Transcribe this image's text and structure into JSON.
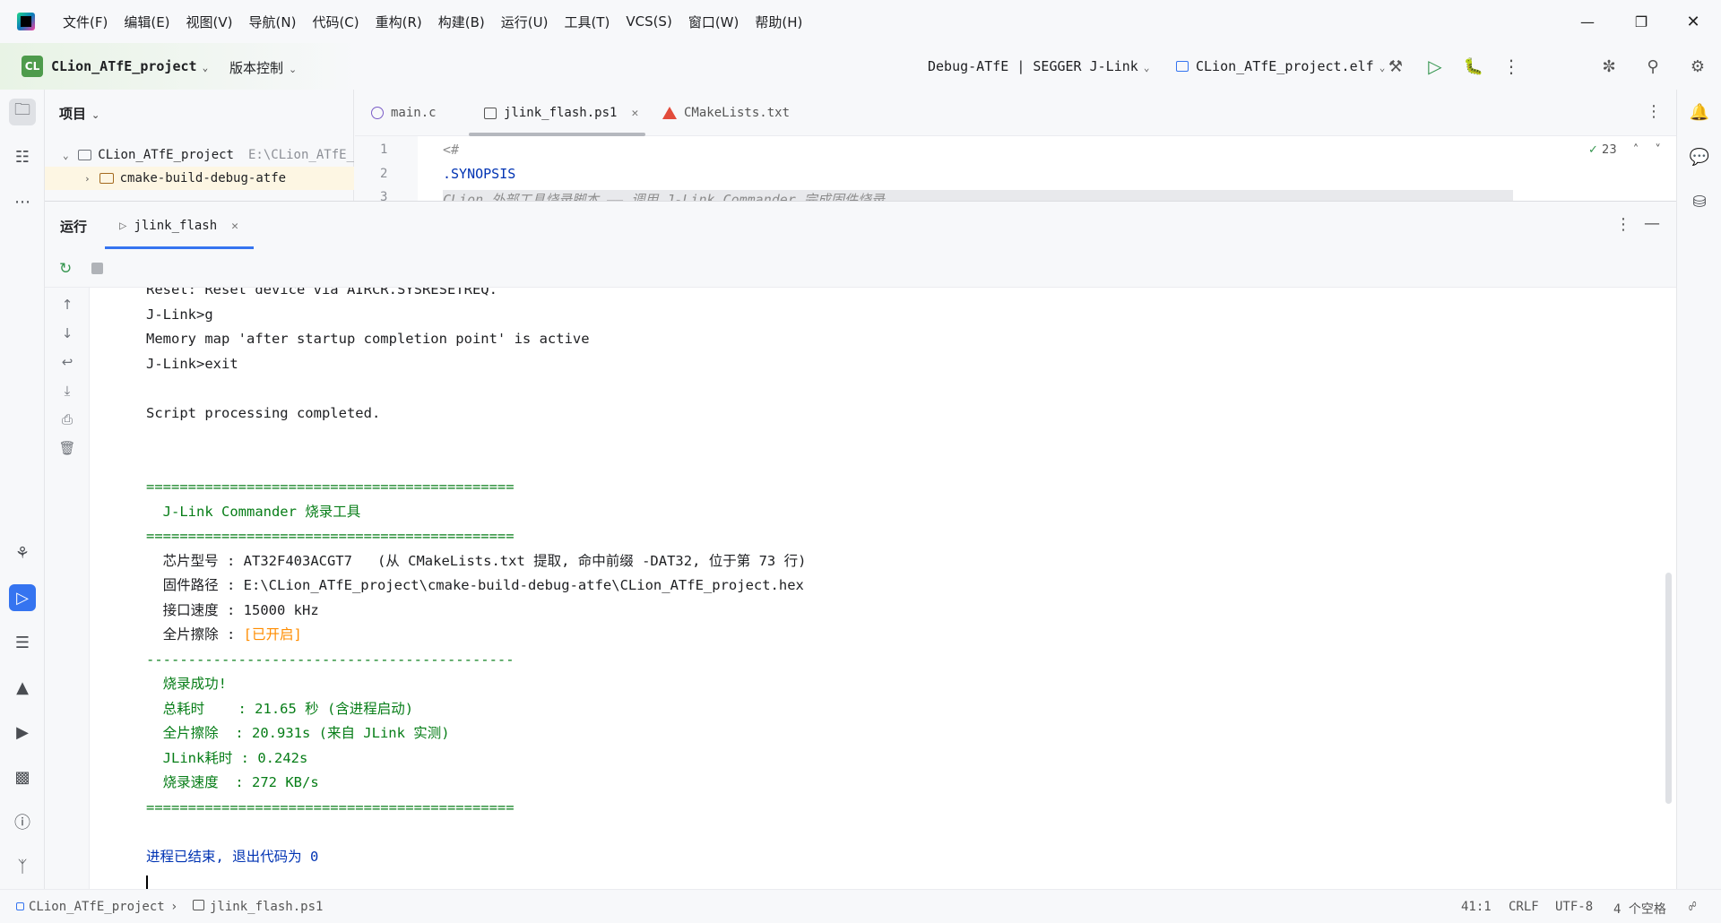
{
  "menubar": {
    "items": [
      "文件(F)",
      "编辑(E)",
      "视图(V)",
      "导航(N)",
      "代码(C)",
      "重构(R)",
      "构建(B)",
      "运行(U)",
      "工具(T)",
      "VCS(S)",
      "窗口(W)",
      "帮助(H)"
    ]
  },
  "toolbar": {
    "project_badge": "CL",
    "project_name": "CLion_ATfE_project",
    "vcs_label": "版本控制",
    "run_config": "Debug-ATfE | SEGGER J-Link",
    "target": "CLion_ATfE_project.elf"
  },
  "project_panel": {
    "title": "项目",
    "root_name": "CLion_ATfE_project",
    "root_path": "E:\\CLion_ATfE_",
    "child": "cmake-build-debug-atfe"
  },
  "editor": {
    "tabs": [
      {
        "label": "main.c"
      },
      {
        "label": "jlink_flash.ps1"
      },
      {
        "label": "CMakeLists.txt"
      }
    ],
    "inspection_count": "23",
    "lines": [
      {
        "no": "1",
        "text": "<#"
      },
      {
        "no": "2",
        "text": ".SYNOPSIS"
      },
      {
        "no": "3",
        "text": "    CLion 外部工具烧录脚本 —— 调用 J-Link Commander 完成固件烧录"
      }
    ]
  },
  "run_window": {
    "title": "运行",
    "tab_label": "jlink_flash",
    "console": [
      {
        "text": "Reset: Reset device via AIRCR.SYSRESETREQ.",
        "style": "clip"
      },
      {
        "text": "J-Link>g",
        "style": "black"
      },
      {
        "text": "Memory map 'after startup completion point' is active",
        "style": "black"
      },
      {
        "text": "J-Link>exit",
        "style": "black"
      },
      {
        "text": "",
        "style": "black"
      },
      {
        "text": "Script processing completed.",
        "style": "black"
      },
      {
        "text": "",
        "style": "black"
      },
      {
        "text": "",
        "style": "black"
      },
      {
        "text": "============================================",
        "style": "green"
      },
      {
        "text": "  J-Link Commander 烧录工具",
        "style": "green"
      },
      {
        "text": "============================================",
        "style": "green"
      },
      {
        "text": "  芯片型号 : AT32F403ACGT7   (从 CMakeLists.txt 提取, 命中前缀 -DAT32, 位于第 73 行)",
        "style": "black"
      },
      {
        "text": "  固件路径 : E:\\CLion_ATfE_project\\cmake-build-debug-atfe\\CLion_ATfE_project.hex",
        "style": "black"
      },
      {
        "text": "  接口速度 : 15000 kHz",
        "style": "black"
      },
      {
        "text": "  全片擦除 : ",
        "style": "black",
        "suffix": "[已开启]"
      },
      {
        "text": "--------------------------------------------",
        "style": "green"
      },
      {
        "text": "  烧录成功!",
        "style": "green"
      },
      {
        "text": "  总耗时    : 21.65 秒 (含进程启动)",
        "style": "green"
      },
      {
        "text": "  全片擦除  : 20.931s (来自 JLink 实测)",
        "style": "green"
      },
      {
        "text": "  JLink耗时 : 0.242s",
        "style": "green"
      },
      {
        "text": "  烧录速度  : 272 KB/s",
        "style": "green"
      },
      {
        "text": "============================================",
        "style": "green"
      },
      {
        "text": "",
        "style": "black"
      },
      {
        "text": "进程已结束, 退出代码为 0",
        "style": "blue"
      }
    ]
  },
  "statusbar": {
    "project": "CLion_ATfE_project",
    "file": "jlink_flash.ps1",
    "position": "41:1",
    "line_sep": "CRLF",
    "encoding": "UTF-8",
    "indent": "4 个空格"
  },
  "colors": {
    "accent": "#3574f0",
    "console_green": "#067d17",
    "console_orange": "#ff8c00",
    "console_blue": "#0033b3"
  }
}
